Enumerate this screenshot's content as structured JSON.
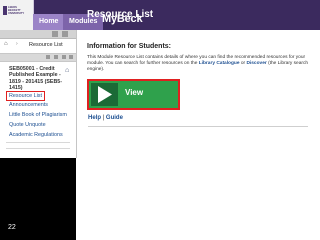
{
  "header": {
    "logo_lines": [
      "Leeds",
      "Beckett",
      "University"
    ],
    "tabs": [
      {
        "label": "Home"
      },
      {
        "label": "Modules"
      }
    ],
    "brand": "MyBeck",
    "page_title": "Resource List"
  },
  "breadcrumb": {
    "current": "Resource List"
  },
  "course_menu": {
    "course_title": "SEB05001 - Credit Published Example - 1819 - 201415 (SEB5-1415)",
    "items": [
      {
        "label": "Resource List",
        "selected": true
      },
      {
        "label": "Announcements",
        "selected": false
      },
      {
        "label": "Little Book of Plagiarism",
        "selected": false
      },
      {
        "label": "Quote Unquote",
        "selected": false
      },
      {
        "label": "Academic Regulations",
        "selected": false
      }
    ]
  },
  "content": {
    "section_heading": "Information for Students:",
    "intro_part1": "This Module Resource List contains details of where you can find the recommended resources for your module. You can search for further resources on the ",
    "intro_link1": "Library Catalogue",
    "intro_part2": " or ",
    "intro_link2": "Discover",
    "intro_part3": " (the Library search engine).",
    "view_button_label": "View",
    "help_link": "Help",
    "separator": "|",
    "guide_link": "Guide"
  },
  "slide_number": "22",
  "colors": {
    "header_bg": "#3b2a5e",
    "view_button_green": "#2fa14c",
    "highlight_red": "#e02020",
    "link_blue": "#1d4f91"
  }
}
